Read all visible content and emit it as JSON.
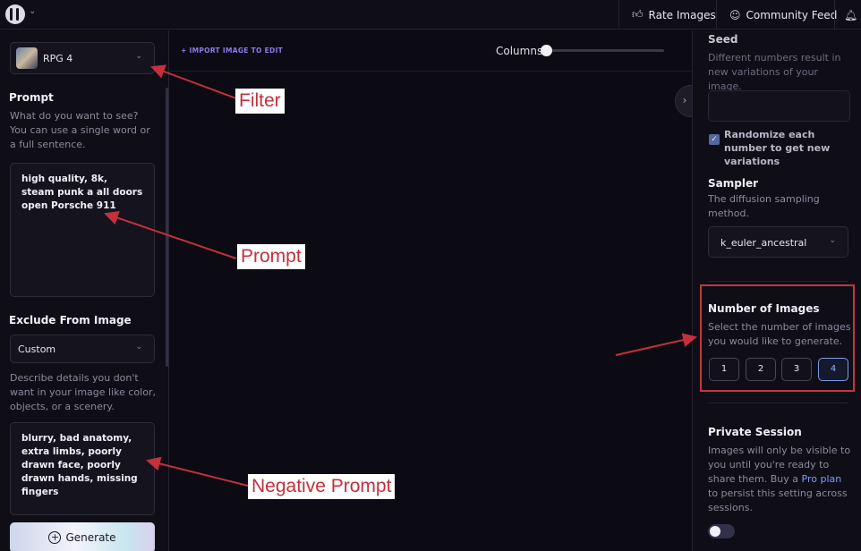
{
  "topbar": {
    "rate_images": "Rate Images",
    "community_feed": "Community Feed"
  },
  "left": {
    "model": "RPG 4",
    "prompt_label": "Prompt",
    "prompt_help": "What do you want to see? You can use a single word or a full sentence.",
    "prompt_value": "high quality, 8k, steam punk a all doors open Porsche 911",
    "exclude_label": "Exclude From Image",
    "exclude_select": "Custom",
    "exclude_help": "Describe details you don't want in your image like color, objects, or a scenery.",
    "negative_value": "blurry, bad anatomy, extra limbs, poorly drawn face, poorly drawn hands, missing fingers",
    "generate": "Generate"
  },
  "center": {
    "import_link": "+ IMPORT IMAGE TO EDIT",
    "columns_label": "Columns"
  },
  "right": {
    "seed_label": "Seed",
    "seed_help": "Different numbers result in new variations of your image.",
    "randomize": "Randomize each number to get new variations",
    "sampler_label": "Sampler",
    "sampler_help": "The diffusion sampling method.",
    "sampler_value": "k_euler_ancestral",
    "num_images_label": "Number of Images",
    "num_images_help": "Select the number of images you would like to generate.",
    "num_options": [
      "1",
      "2",
      "3",
      "4"
    ],
    "num_selected": "4",
    "private_label": "Private Session",
    "private_help_1": "Images will only be visible to you until you're ready to share them. Buy a ",
    "private_link": "Pro plan",
    "private_help_2": " to persist this setting across sessions."
  },
  "annotations": {
    "filter": "Filter",
    "prompt": "Prompt",
    "negative": "Negative Prompt"
  },
  "colors": {
    "annotation_red": "#c4303c",
    "accent_blue": "#7e9bff",
    "import_purple": "#8a7bf0"
  }
}
